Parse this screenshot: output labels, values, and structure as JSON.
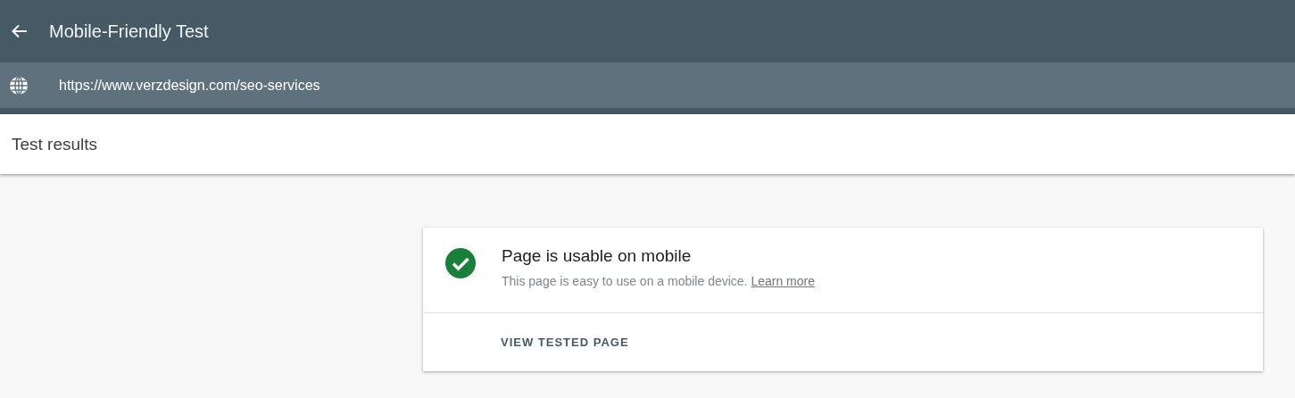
{
  "app_bar": {
    "title": "Mobile-Friendly Test"
  },
  "url_bar": {
    "value": "https://www.verzdesign.com/seo-services"
  },
  "section": {
    "title": "Test results"
  },
  "result": {
    "passed": true,
    "heading": "Page is usable on mobile",
    "description": "This page is easy to use on a mobile device.",
    "link": "Learn more",
    "action": "VIEW TESTED PAGE"
  }
}
